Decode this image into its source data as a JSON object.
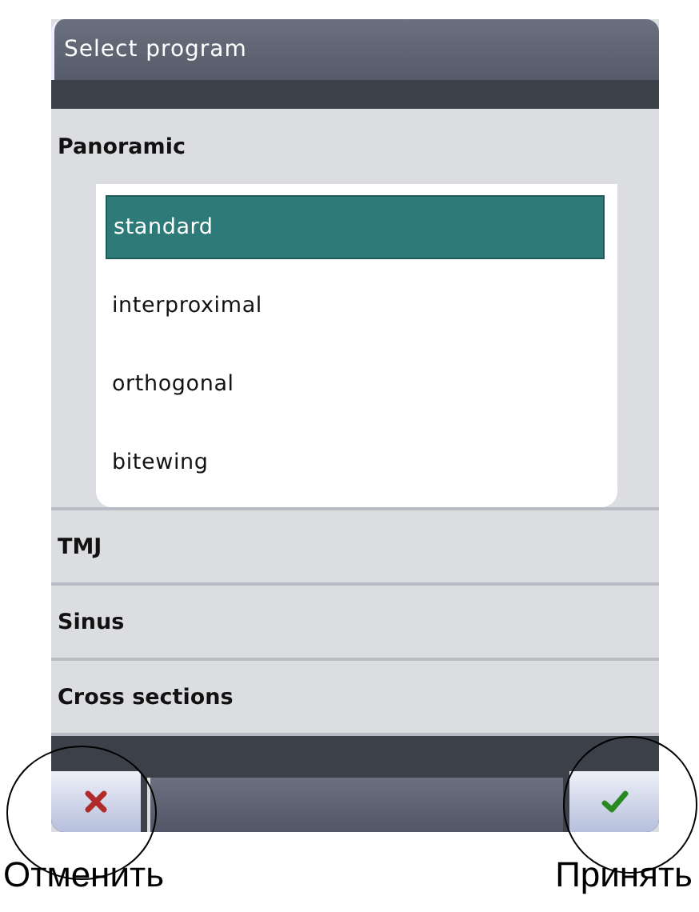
{
  "window": {
    "title": "Select program"
  },
  "groups": [
    {
      "label": "Panoramic",
      "expanded": true,
      "programs": [
        {
          "label": "standard",
          "selected": true
        },
        {
          "label": "interproximal",
          "selected": false
        },
        {
          "label": "orthogonal",
          "selected": false
        },
        {
          "label": "bitewing",
          "selected": false
        }
      ]
    },
    {
      "label": "TMJ",
      "expanded": false
    },
    {
      "label": "Sinus",
      "expanded": false
    },
    {
      "label": "Cross sections",
      "expanded": false
    }
  ],
  "buttons": [
    {
      "kind": "cancel"
    },
    {
      "kind": "accept"
    }
  ],
  "annotations": [
    {
      "label": "Отменить"
    },
    {
      "label": "Принять"
    }
  ]
}
